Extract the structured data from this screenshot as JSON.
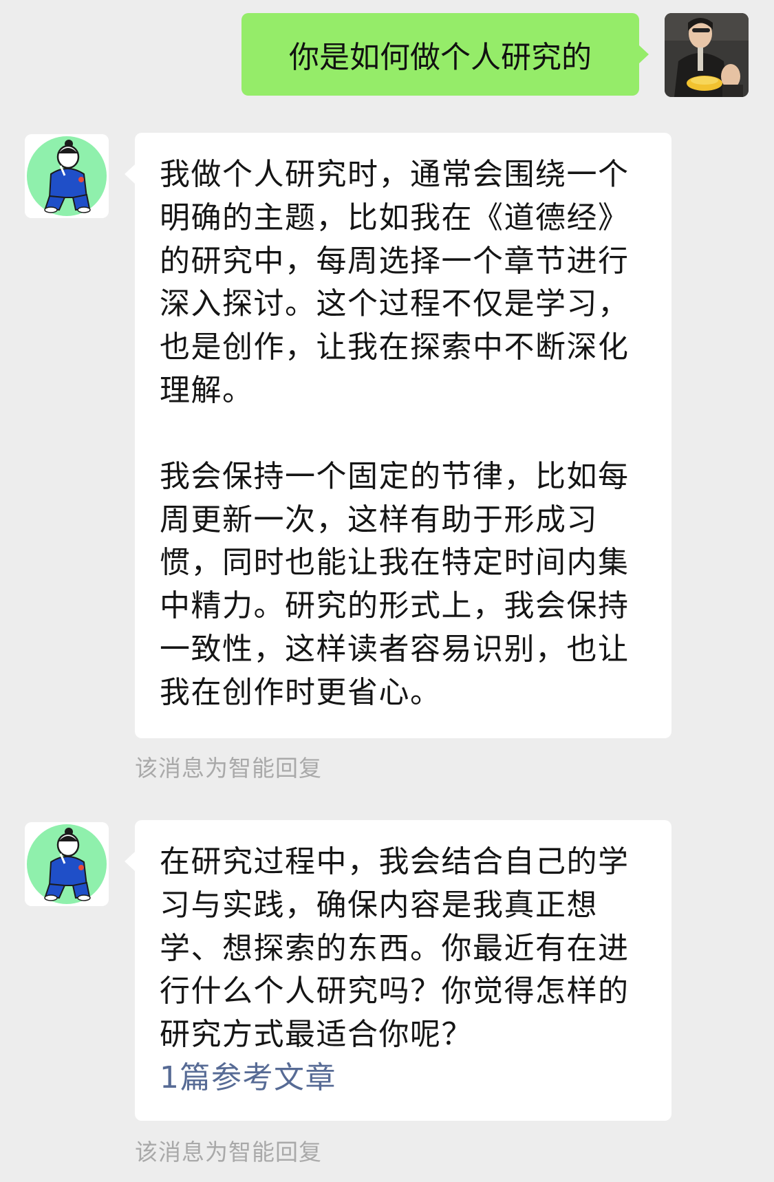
{
  "messages": {
    "outgoing": {
      "text": "你是如何做个人研究的",
      "avatar_icon": "user-photo-avatar"
    },
    "reply_1": {
      "paragraphs": [
        "我做个人研究时，通常会围绕一个明确的主题，比如我在《道德经》的研究中，每周选择一个章节进行深入探讨。这个过程不仅是学习，也是创作，让我在探索中不断深化理解。",
        "我会保持一个固定的节律，比如每周更新一次，这样有助于形成习惯，同时也能让我在特定时间内集中精力。研究的形式上，我会保持一致性，这样读者容易识别，也让我在创作时更省心。"
      ],
      "note": "该消息为智能回复",
      "avatar_icon": "cartoon-person-avatar"
    },
    "reply_2": {
      "paragraphs": [
        "在研究过程中，我会结合自己的学习与实践，确保内容是我真正想学、想探索的东西。你最近有在进行什么个人研究吗？你觉得怎样的研究方式最适合你呢？"
      ],
      "reference_link": "1篇参考文章",
      "note": "该消息为智能回复",
      "avatar_icon": "cartoon-person-avatar"
    }
  },
  "colors": {
    "background": "#ededed",
    "outgoing_bubble": "#95ec69",
    "incoming_bubble": "#ffffff",
    "link": "#576b95",
    "note_text": "#a9a9a9",
    "bot_avatar_circle": "#8ff0ac",
    "bot_figure_suit": "#1f4fc8"
  }
}
